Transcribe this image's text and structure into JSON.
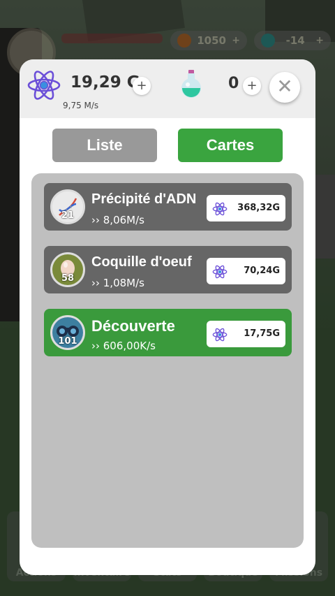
{
  "hud": {
    "coins": "1050",
    "gems": "-14",
    "plus": "+"
  },
  "bottom_nav": [
    "Actions",
    "Inventaire",
    "Stats",
    "Boutique",
    "Missions"
  ],
  "header": {
    "atom_value": "19,29 G",
    "atom_rate": "9,75 M/s",
    "plus": "+",
    "potion_value": "0",
    "close": "✕"
  },
  "tabs": {
    "liste": "Liste",
    "cartes": "Cartes",
    "active": "cartes"
  },
  "cards": [
    {
      "name": "Précipité d'ADN",
      "level": "21",
      "rate": "›› 8,06M/s",
      "price": "368,32G",
      "style": "gray",
      "icon": "dna-icon"
    },
    {
      "name": "Coquille d'oeuf",
      "level": "58",
      "rate": "›› 1,08M/s",
      "price": "70,24G",
      "style": "gray",
      "icon": "egg-icon"
    },
    {
      "name": "Découverte",
      "level": "101",
      "rate": "›› 606,00K/s",
      "price": "17,75G",
      "style": "green",
      "icon": "binoculars-icon"
    }
  ],
  "colors": {
    "accent_green": "#3aa43f",
    "tab_inactive": "#999999",
    "card_gray": "#666666",
    "atom_purple": "#6b4fd8"
  }
}
